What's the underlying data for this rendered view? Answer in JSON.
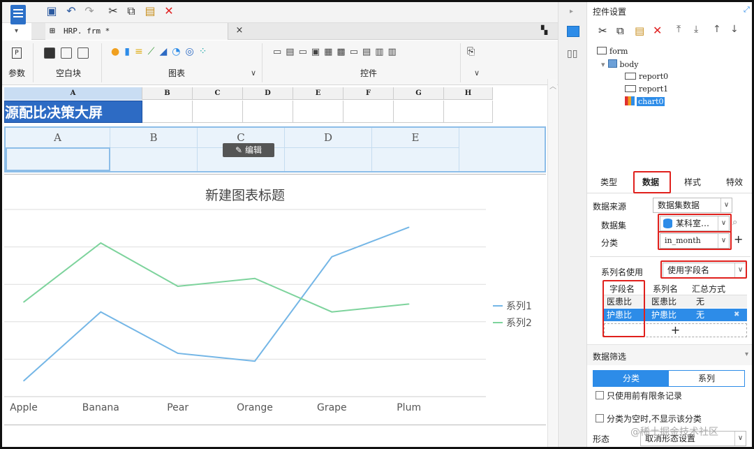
{
  "toolbar": {
    "tab_label": "HRP. frm *",
    "close": "×"
  },
  "ribbon": {
    "groups": [
      {
        "label": "参数"
      },
      {
        "label": "空白块"
      },
      {
        "label": "图表"
      },
      {
        "label": "控件"
      }
    ]
  },
  "sheet": {
    "columns": [
      "A",
      "B",
      "C",
      "D",
      "E",
      "F",
      "G",
      "H"
    ],
    "title_cell": "源配比决策大屏",
    "report_columns": [
      "A",
      "B",
      "C",
      "D",
      "E"
    ],
    "edit_button": "编辑"
  },
  "chart_data": {
    "type": "line",
    "title": "新建图表标题",
    "categories": [
      "Apple",
      "Banana",
      "Pear",
      "Orange",
      "Grape",
      "Plum"
    ],
    "series": [
      {
        "name": "系列1",
        "color": "#74b6e6",
        "values": [
          1.3,
          4.8,
          2.7,
          2.3,
          7.6,
          9.1
        ]
      },
      {
        "name": "系列2",
        "color": "#7dd39c",
        "values": [
          5.3,
          8.3,
          6.1,
          6.5,
          4.8,
          5.2
        ]
      }
    ],
    "ylim": [
      0.5,
      10
    ],
    "grid": true,
    "legend": "right"
  },
  "panel": {
    "title": "控件设置",
    "tree": {
      "root": "form",
      "body": "body",
      "items": [
        "report0",
        "report1",
        "chart0"
      ]
    },
    "tabs": [
      "类型",
      "数据",
      "样式",
      "特效"
    ],
    "data_source_label": "数据来源",
    "data_source_value": "数据集数据",
    "dataset_label": "数据集",
    "dataset_value": "某科室…",
    "category_label": "分类",
    "category_value": "in_month",
    "series_name_label": "系列名使用",
    "series_name_value": "使用字段名",
    "table_headers": [
      "字段名",
      "系列名",
      "汇总方式"
    ],
    "table_rows": [
      [
        "医患比",
        "医患比",
        "无"
      ],
      [
        "护患比",
        "护患比",
        "无"
      ]
    ],
    "add": "+",
    "filter_label": "数据筛选",
    "segment": [
      "分类",
      "系列"
    ],
    "check1": "只使用前有限条记录",
    "check2": "分类为空时,不显示该分类",
    "form_label": "形态",
    "form_value": "取消形态设置"
  },
  "watermark": "@稀土掘金技术社区"
}
